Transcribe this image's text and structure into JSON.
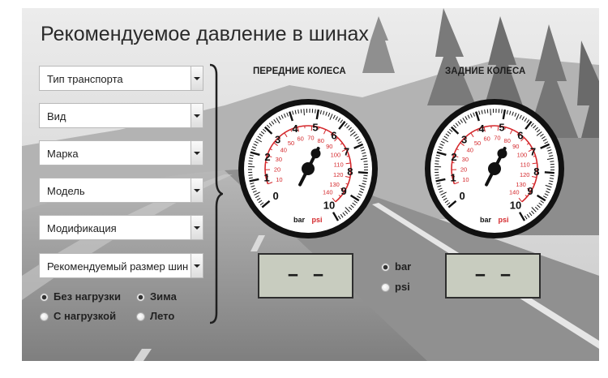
{
  "app": {
    "title": "Рекомендуемое давление в шинах"
  },
  "selectors": [
    {
      "id": "vehicle-type",
      "value": "Тип транспорта"
    },
    {
      "id": "kind",
      "value": "Вид"
    },
    {
      "id": "brand",
      "value": "Марка"
    },
    {
      "id": "model",
      "value": "Модель"
    },
    {
      "id": "modification",
      "value": "Модификация"
    },
    {
      "id": "tire-size",
      "value": "Рекомендуемый размер шин"
    }
  ],
  "load": {
    "no_load": {
      "label": "Без нагрузки",
      "checked": true
    },
    "with_load": {
      "label": "С нагрузкой",
      "checked": false
    }
  },
  "season": {
    "winter": {
      "label": "Зима",
      "checked": true
    },
    "summer": {
      "label": "Лето",
      "checked": false
    }
  },
  "gauges": {
    "front": {
      "title": "ПЕРЕДНИЕ КОЛЕСА",
      "display": "– –"
    },
    "rear": {
      "title": "ЗАДНИЕ КОЛЕСА",
      "display": "– –"
    },
    "bar_scale": [
      "0",
      "1",
      "2",
      "3",
      "4",
      "5",
      "6",
      "7",
      "8",
      "9",
      "10"
    ],
    "psi_scale": [
      "10",
      "20",
      "30",
      "40",
      "50",
      "60",
      "70",
      "80",
      "90",
      "100",
      "110",
      "120",
      "130",
      "140"
    ],
    "bar_unit": "bar",
    "psi_unit": "psi",
    "needle_value_bar": 5.6
  },
  "units": {
    "bar": {
      "label": "bar",
      "checked": true
    },
    "psi": {
      "label": "psi",
      "checked": false
    }
  },
  "colors": {
    "psi_red": "#d4282c",
    "display_bg": "#c8ccbf"
  }
}
